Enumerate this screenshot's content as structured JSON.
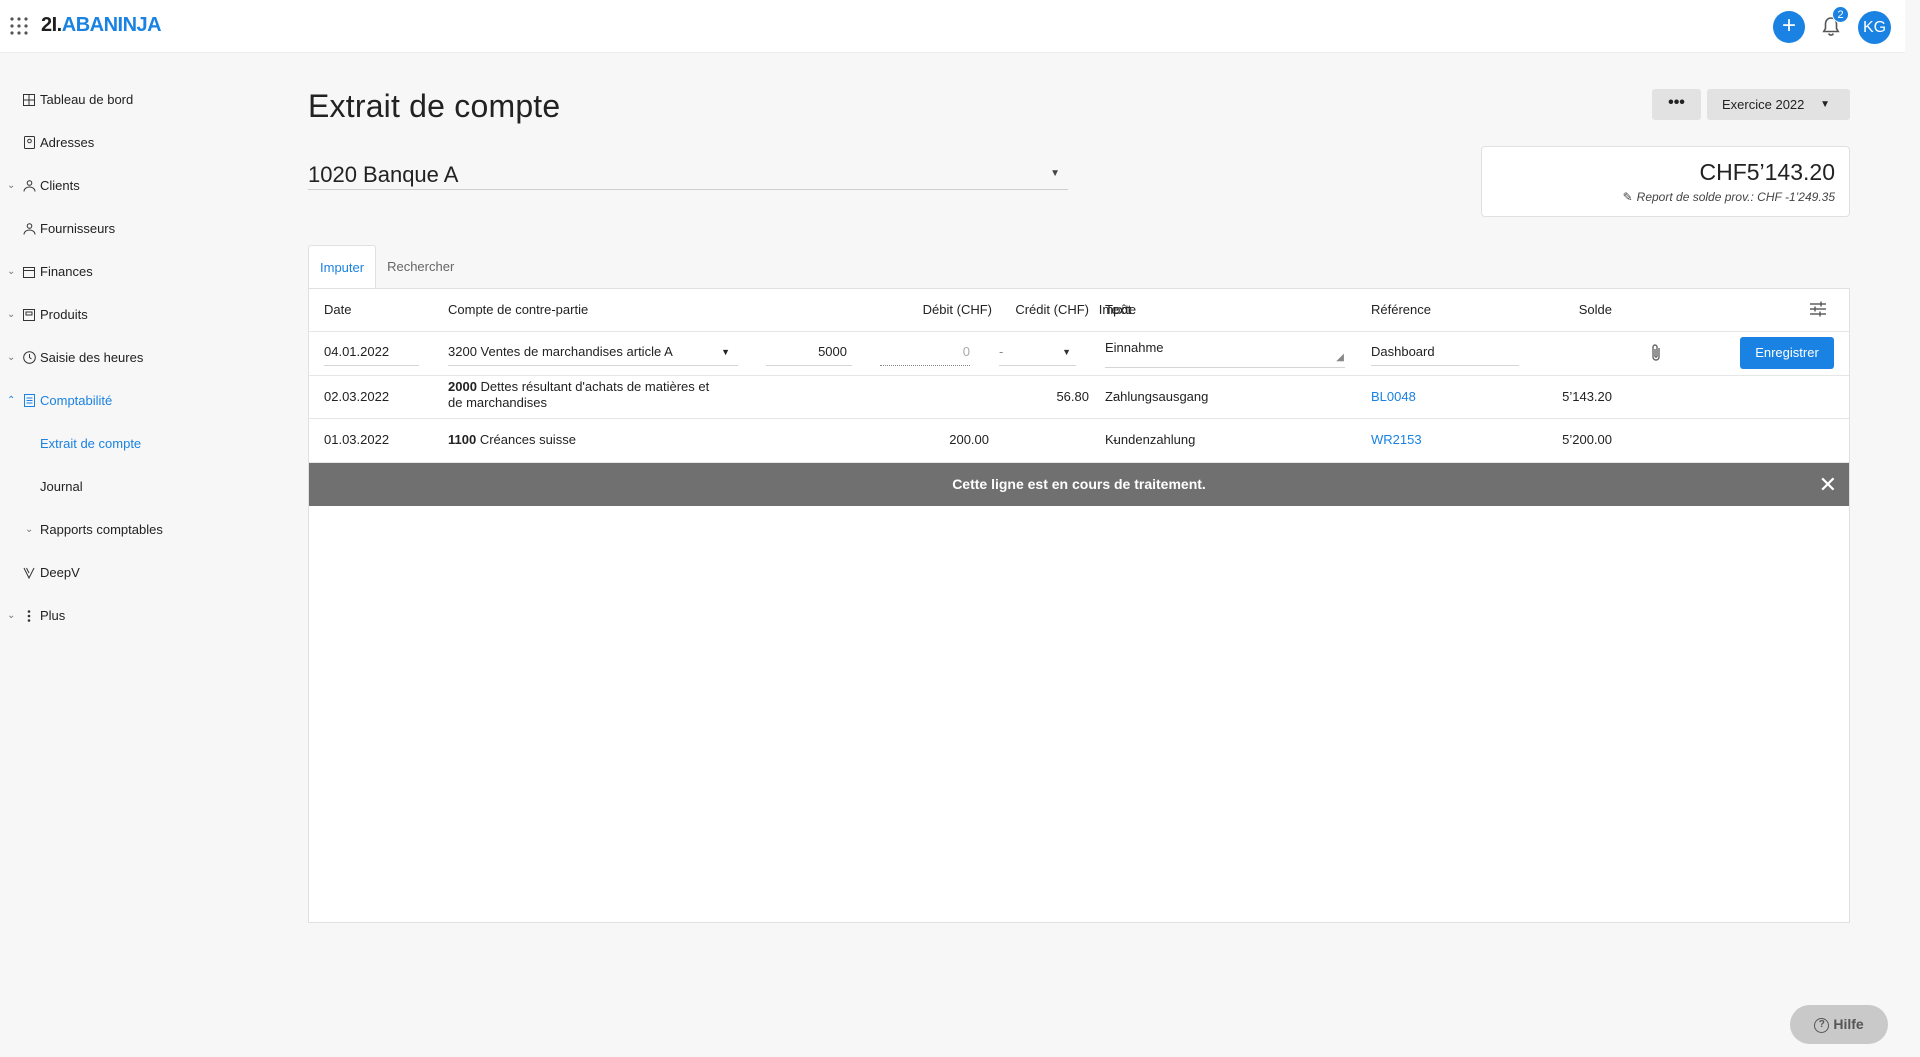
{
  "app": {
    "logo_num": "2I.",
    "logo_brand": "ABANINJA",
    "notifications": "2",
    "avatar_initials": "KG",
    "plus_label": "+"
  },
  "sidebar": {
    "items": [
      {
        "label": "Tableau de bord",
        "icon": "dashboard-icon"
      },
      {
        "label": "Adresses",
        "icon": "address-book-icon"
      },
      {
        "label": "Clients",
        "icon": "users-icon"
      },
      {
        "label": "Fournisseurs",
        "icon": "users-icon"
      },
      {
        "label": "Finances",
        "icon": "calendar-icon"
      },
      {
        "label": "Produits",
        "icon": "box-icon"
      },
      {
        "label": "Saisie des heures",
        "icon": "clock-icon"
      },
      {
        "label": "Comptabilité",
        "icon": "ledger-icon"
      },
      {
        "label": "Extrait de compte"
      },
      {
        "label": "Journal"
      },
      {
        "label": "Rapports comptables"
      },
      {
        "label": "DeepV",
        "icon": "deepv-icon"
      },
      {
        "label": "Plus",
        "icon": "more-vertical-icon"
      }
    ]
  },
  "header": {
    "title": "Extrait de compte",
    "more_label": "•••",
    "year_label": "Exercice 2022"
  },
  "account": {
    "selected": "1020 Banque A"
  },
  "balance": {
    "amount": "CHF5’143.20",
    "note": "Report de solde prov.: CHF -1’249.35"
  },
  "tabs": [
    "Imputer",
    "Rechercher"
  ],
  "table": {
    "columns": [
      "Date",
      "Compte de contre-partie",
      "Débit (CHF)",
      "Crédit (CHF)",
      "Impôt",
      "Texte",
      "Référence",
      "Solde"
    ],
    "edit_row": {
      "date": "04.01.2022",
      "account": "3200 Ventes de marchandises article A",
      "debit": "5000",
      "credit_placeholder": "0",
      "tax": "-",
      "text": "Einnahme",
      "reference": "Dashboard",
      "save_label": "Enregistrer"
    },
    "rows": [
      {
        "date": "02.03.2022",
        "account_no": "2000",
        "account_name_1": "Dettes résultant d'achats de matières et",
        "account_name_2": "de marchandises",
        "debit": "",
        "credit": "56.80",
        "tax": "-",
        "text": "Zahlungsausgang",
        "reference": "BL0048",
        "balance": "5’143.20"
      },
      {
        "date": "01.03.2022",
        "account_no": "1100",
        "account_name_1": "Créances suisse",
        "account_name_2": "",
        "debit": "200.00",
        "credit": "",
        "tax": "-",
        "text": "Kundenzahlung",
        "reference": "WR2153",
        "balance": "5’200.00"
      }
    ],
    "banner": "Cette ligne est en cours de traitement."
  },
  "help": {
    "label": "Hilfe"
  },
  "colors": {
    "accent": "#1a82e2",
    "banner": "#707070",
    "background": "#f7f7f7"
  }
}
